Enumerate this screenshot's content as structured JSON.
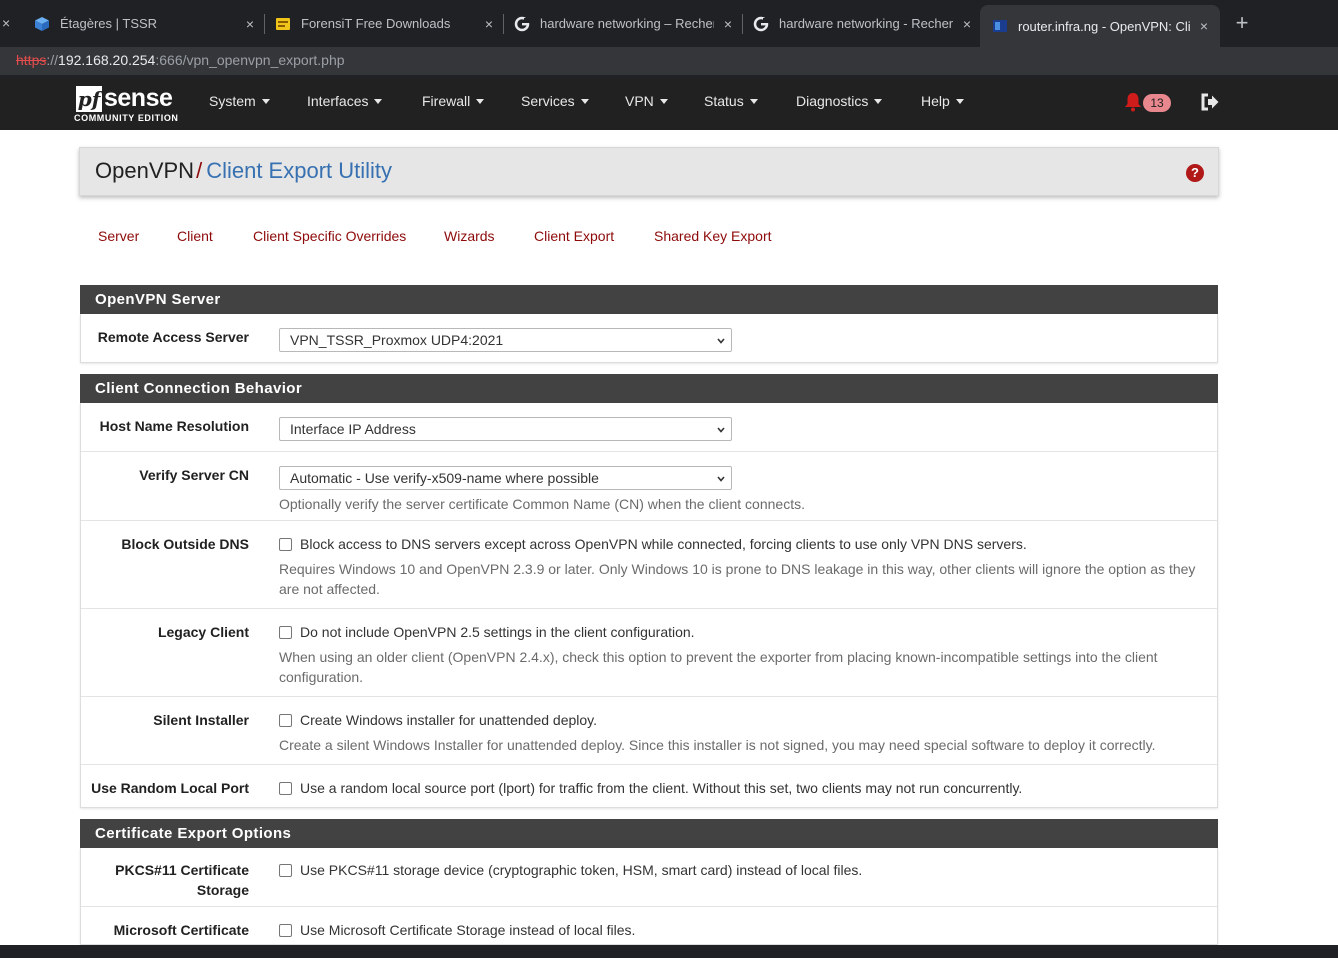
{
  "browser": {
    "tabs": [
      {
        "title": "Étagères | TSSR"
      },
      {
        "title": "ForensiT Free Downloads"
      },
      {
        "title": "hardware networking – Recherche"
      },
      {
        "title": "hardware networking - Recherche"
      },
      {
        "title": "router.infra.ng - OpenVPN: Client"
      }
    ],
    "close_glyph": "×",
    "new_tab_glyph": "+",
    "url_proto": "https",
    "url_sep": "://",
    "url_host": "192.168.20.254",
    "url_rest": ":666/vpn_openvpn_export.php"
  },
  "nav": {
    "logo_pf": "pf",
    "logo_sense": "sense",
    "logo_edition": "COMMUNITY EDITION",
    "menu": [
      "System",
      "Interfaces",
      "Firewall",
      "Services",
      "VPN",
      "Status",
      "Diagnostics",
      "Help"
    ],
    "notification_count": "13"
  },
  "header": {
    "crumb_parent": "OpenVPN",
    "crumb_sep": "/",
    "crumb_active": "Client Export Utility",
    "help_glyph": "?"
  },
  "tabs": [
    "Server",
    "Client",
    "Client Specific Overrides",
    "Wizards",
    "Client Export",
    "Shared Key Export"
  ],
  "panels": {
    "server": {
      "title": "OpenVPN Server",
      "remote_access_label": "Remote Access Server",
      "remote_access_value": "VPN_TSSR_Proxmox UDP4:2021"
    },
    "behavior": {
      "title": "Client Connection Behavior",
      "host_label": "Host Name Resolution",
      "host_value": "Interface IP Address",
      "verify_label": "Verify Server CN",
      "verify_value": "Automatic - Use verify-x509-name where possible",
      "verify_help": "Optionally verify the server certificate Common Name (CN) when the client connects.",
      "dns_label": "Block Outside DNS",
      "dns_text": "Block access to DNS servers except across OpenVPN while connected, forcing clients to use only VPN DNS servers.",
      "dns_help": "Requires Windows 10 and OpenVPN 2.3.9 or later. Only Windows 10 is prone to DNS leakage in this way, other clients will ignore the option as they are not affected.",
      "legacy_label": "Legacy Client",
      "legacy_text": "Do not include OpenVPN 2.5 settings in the client configuration.",
      "legacy_help": "When using an older client (OpenVPN 2.4.x), check this option to prevent the exporter from placing known-incompatible settings into the client configuration.",
      "silent_label": "Silent Installer",
      "silent_text": "Create Windows installer for unattended deploy.",
      "silent_help": "Create a silent Windows Installer for unattended deploy. Since this installer is not signed, you may need special software to deploy it correctly.",
      "random_label": "Use Random Local Port",
      "random_text": "Use a random local source port (lport) for traffic from the client. Without this set, two clients may not run concurrently."
    },
    "cert": {
      "title": "Certificate Export Options",
      "pkcs_label": "PKCS#11 Certificate Storage",
      "pkcs_text": "Use PKCS#11 storage device (cryptographic token, HSM, smart card) instead of local files.",
      "ms_label": "Microsoft Certificate",
      "ms_text": "Use Microsoft Certificate Storage instead of local files."
    }
  },
  "colors": {
    "navbar": "#212121",
    "panel_heading": "#424242",
    "link_red": "#8e0a0a",
    "crumb_blue": "#3771b2",
    "alert_red": "#b11919"
  },
  "icons": {
    "tab_icons": [
      "shelf-icon",
      "forensit-icon",
      "google-icon",
      "google-icon",
      "pfsense-icon"
    ],
    "bell": "bell-icon",
    "logout": "logout-icon",
    "help": "question-circle-icon"
  }
}
